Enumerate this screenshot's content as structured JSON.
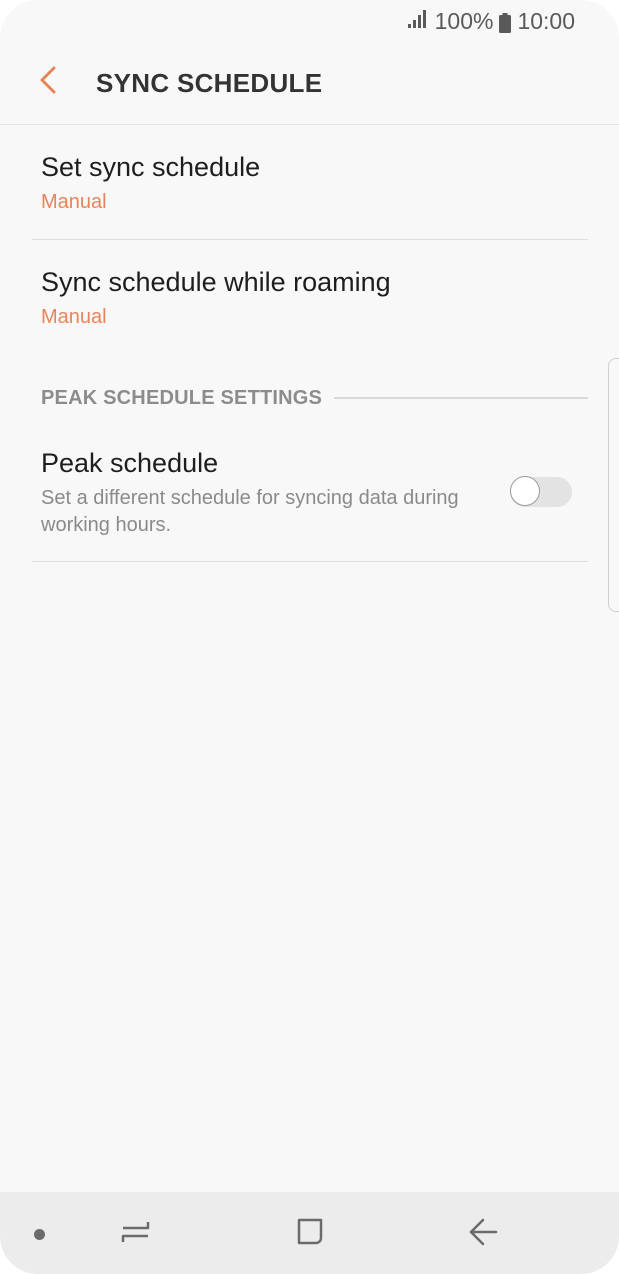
{
  "status": {
    "battery": "100%",
    "time": "10:00",
    "icons": [
      "signal-icon",
      "battery-icon"
    ]
  },
  "appbar": {
    "title": "SYNC SCHEDULE",
    "back_icon": "chevron-left-icon"
  },
  "settings": [
    {
      "title": "Set sync schedule",
      "value": "Manual"
    },
    {
      "title": "Sync schedule while roaming",
      "value": "Manual"
    }
  ],
  "peak_section": {
    "header": "PEAK SCHEDULE SETTINGS",
    "title": "Peak schedule",
    "description": "Set a different schedule for syncing data during working hours.",
    "toggle_on": false
  },
  "navbar": {
    "icons": [
      "nav-dot-icon",
      "recent-apps-icon",
      "home-icon",
      "back-icon"
    ]
  },
  "colors": {
    "accent": "#e8845a",
    "background": "#f8f8f8",
    "navbar": "#ececec"
  }
}
